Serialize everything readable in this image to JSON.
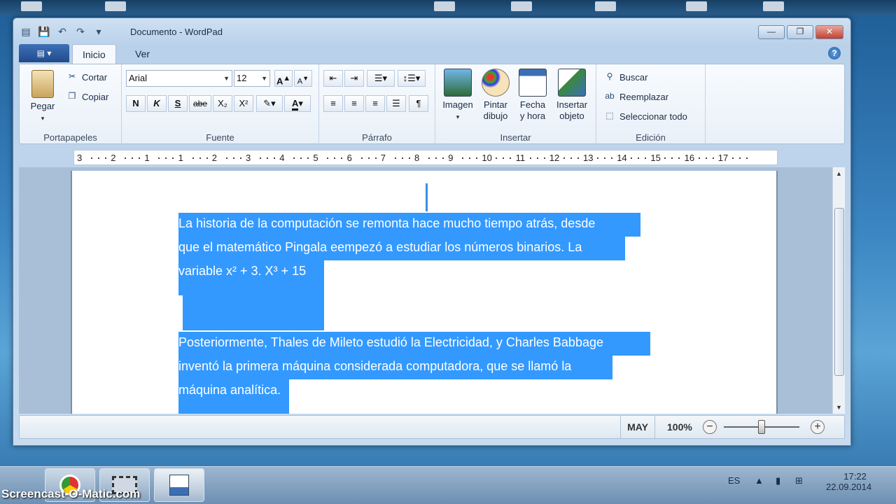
{
  "window": {
    "title": "Documento - WordPad",
    "controls": {
      "minimize": "—",
      "maximize": "❐",
      "close": "✕"
    }
  },
  "tabs": [
    {
      "label": "Inicio"
    },
    {
      "label": "Ver"
    }
  ],
  "ribbon": {
    "portapapeles": {
      "label": "Portapapeles",
      "pegar": "Pegar",
      "cortar": "Cortar",
      "copiar": "Copiar"
    },
    "fuente": {
      "label": "Fuente",
      "font_name": "Arial",
      "font_size": "12",
      "bold": "N",
      "italic": "K",
      "underline": "S",
      "strike": "abe",
      "sub": "X₂",
      "sup": "X²"
    },
    "parrafo": {
      "label": "Párrafo"
    },
    "insertar": {
      "label": "Insertar",
      "imagen": "Imagen",
      "pintar": "Pintar\ndibujo",
      "pintar_1": "Pintar",
      "pintar_2": "dibujo",
      "fecha_1": "Fecha",
      "fecha_2": "y hora",
      "objeto_1": "Insertar",
      "objeto_2": "objeto"
    },
    "edicion": {
      "label": "Edición",
      "buscar": "Buscar",
      "reemplazar": "Reemplazar",
      "seleccionar": "Seleccionar todo"
    }
  },
  "ruler": {
    "numbers": [
      "3",
      "2",
      "1",
      "1",
      "2",
      "3",
      "4",
      "5",
      "6",
      "7",
      "8",
      "9",
      "10",
      "11",
      "12",
      "13",
      "14",
      "15",
      "16",
      "17"
    ]
  },
  "document": {
    "lines": [
      "La historia de la computación se remonta hace mucho tiempo atrás, desde",
      "que el matemático Pingala eempezó a estudiar los números binarios. La",
      "variable x² + 3.  X³ + 15",
      "Posteriormente, Thales de Mileto estudió la Electricidad, y Charles Babbage",
      "inventó la primera máquina considerada computadora, que se llamó la",
      "máquina analítica."
    ]
  },
  "status": {
    "caps": "MAY",
    "zoom": "100%",
    "zoom_level": 1.0
  },
  "taskbar": {
    "lang": "ES",
    "time": "17:22",
    "date": "22.09.2014"
  },
  "watermark": "Screencast-O-Matic.com"
}
